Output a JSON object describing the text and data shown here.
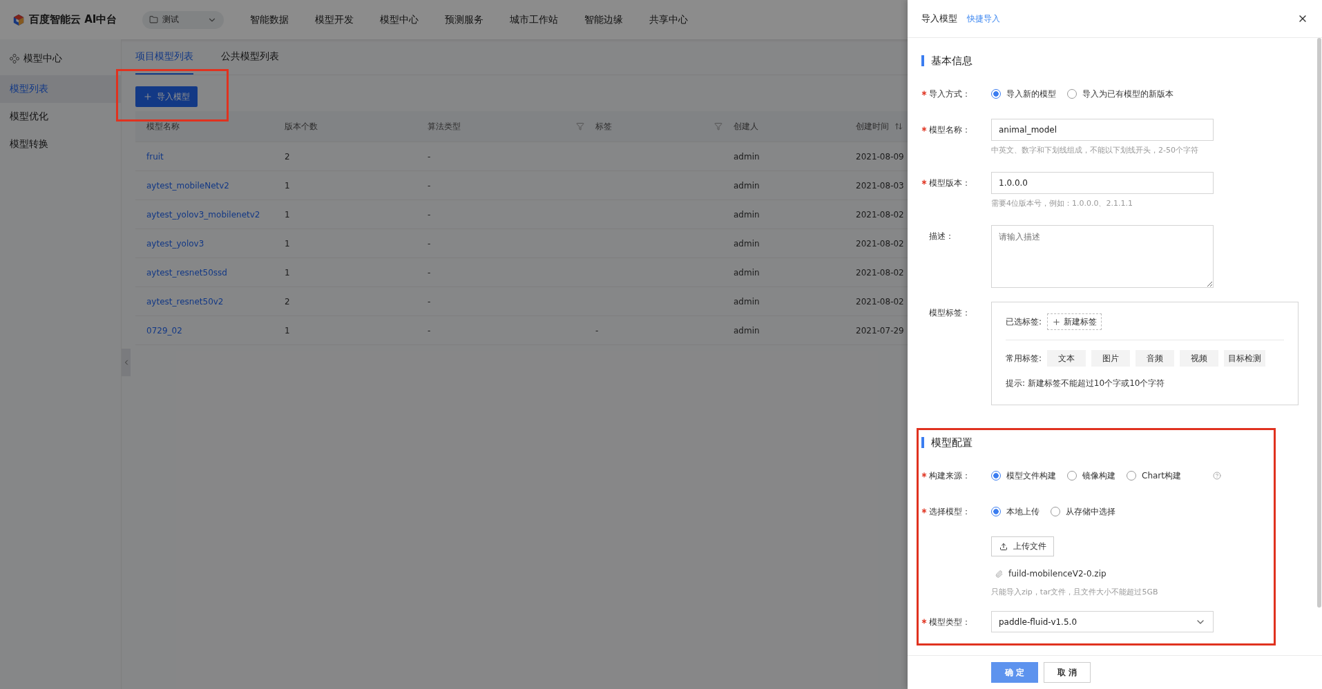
{
  "top_nav": {
    "logo_text": "百度智能云 AI中台",
    "project_select": "测试",
    "items": [
      {
        "label": "智能数据",
        "selected": false
      },
      {
        "label": "模型开发",
        "selected": false
      },
      {
        "label": "模型中心",
        "selected": false
      },
      {
        "label": "预测服务",
        "selected": false
      },
      {
        "label": "城市工作站",
        "selected": false
      },
      {
        "label": "智能边缘",
        "selected": false
      },
      {
        "label": "共享中心",
        "selected": false
      }
    ]
  },
  "sidebar": {
    "title": "模型中心",
    "items": [
      {
        "label": "模型列表",
        "selected": true
      },
      {
        "label": "模型优化",
        "selected": false
      },
      {
        "label": "模型转换",
        "selected": false
      }
    ]
  },
  "tabs": [
    {
      "label": "项目模型列表",
      "selected": true
    },
    {
      "label": "公共模型列表",
      "selected": false
    }
  ],
  "import_button": "导入模型",
  "table": {
    "columns": [
      {
        "label": "模型名称",
        "kind": "plain"
      },
      {
        "label": "版本个数",
        "kind": "plain"
      },
      {
        "label": "算法类型",
        "kind": "filter"
      },
      {
        "label": "标签",
        "kind": "filter"
      },
      {
        "label": "创建人",
        "kind": "plain"
      },
      {
        "label": "创建时间",
        "kind": "sort"
      }
    ],
    "rows": [
      {
        "name": "fruit",
        "versions": "2",
        "algorithm": "-",
        "creator": "admin",
        "created": "2021-08-09"
      },
      {
        "name": "aytest_mobileNetv2",
        "versions": "1",
        "algorithm": "-",
        "creator": "admin",
        "created": "2021-08-03"
      },
      {
        "name": "aytest_yolov3_mobilenetv2",
        "versions": "1",
        "algorithm": "-",
        "creator": "admin",
        "created": "2021-08-02"
      },
      {
        "name": "aytest_yolov3",
        "versions": "1",
        "algorithm": "-",
        "creator": "admin",
        "created": "2021-08-02"
      },
      {
        "name": "aytest_resnet50ssd",
        "versions": "1",
        "algorithm": "-",
        "creator": "admin",
        "created": "2021-08-02"
      },
      {
        "name": "aytest_resnet50v2",
        "versions": "2",
        "algorithm": "-",
        "creator": "admin",
        "created": "2021-08-02"
      },
      {
        "name": "0729_02",
        "versions": "1",
        "algorithm": "-",
        "tags": "-",
        "creator": "admin",
        "created": "2021-07-29"
      }
    ]
  },
  "drawer": {
    "title": "导入模型",
    "link": "快捷导入",
    "sections": [
      {
        "title": "基本信息",
        "fields": [
          {
            "kind": "radio",
            "label": "导入方式：",
            "required": true,
            "options": [
              {
                "label": "导入新的模型",
                "selected": true
              },
              {
                "label": "导入为已有模型的新版本",
                "selected": false
              }
            ]
          },
          {
            "kind": "input",
            "label": "模型名称：",
            "required": true,
            "value": "animal_model",
            "hint": "中英文、数字和下划线组成，不能以下划线开头，2-50个字符"
          },
          {
            "kind": "input",
            "label": "模型版本：",
            "required": true,
            "value": "1.0.0.0",
            "hint": "需要4位版本号，例如：1.0.0.0、2.1.1.1"
          },
          {
            "kind": "textarea",
            "label": "描述：",
            "required": false,
            "placeholder": "请输入描述"
          },
          {
            "kind": "tags",
            "label": "模型标签：",
            "required": false,
            "selected_label": "已选标签:",
            "new_tag": "新建标签",
            "common_label": "常用标签:",
            "common_tags": [
              "文本",
              "图片",
              "音频",
              "视频",
              "目标检测"
            ],
            "tip": "提示: 新建标签不能超过10个字或10个字符"
          }
        ]
      },
      {
        "title": "模型配置",
        "fields": [
          {
            "kind": "radio",
            "label": "构建来源：",
            "required": true,
            "help": true,
            "options": [
              {
                "label": "模型文件构建",
                "selected": true
              },
              {
                "label": "镜像构建",
                "selected": false
              },
              {
                "label": "Chart构建",
                "selected": false
              }
            ]
          },
          {
            "kind": "radio",
            "label": "选择模型：",
            "required": true,
            "options": [
              {
                "label": "本地上传",
                "selected": true
              },
              {
                "label": "从存储中选择",
                "selected": false
              }
            ]
          },
          {
            "kind": "upload",
            "button": "上传文件",
            "file": "fuild-mobilenceV2-0.zip",
            "hint": "只能导入zip，tar文件，且文件大小不能超过5GB"
          },
          {
            "kind": "select",
            "label": "模型类型：",
            "required": true,
            "value": "paddle-fluid-v1.5.0"
          }
        ]
      }
    ],
    "buttons": [
      {
        "label": "确 定",
        "kind": "primary"
      },
      {
        "label": "取 消",
        "kind": "default"
      }
    ]
  }
}
